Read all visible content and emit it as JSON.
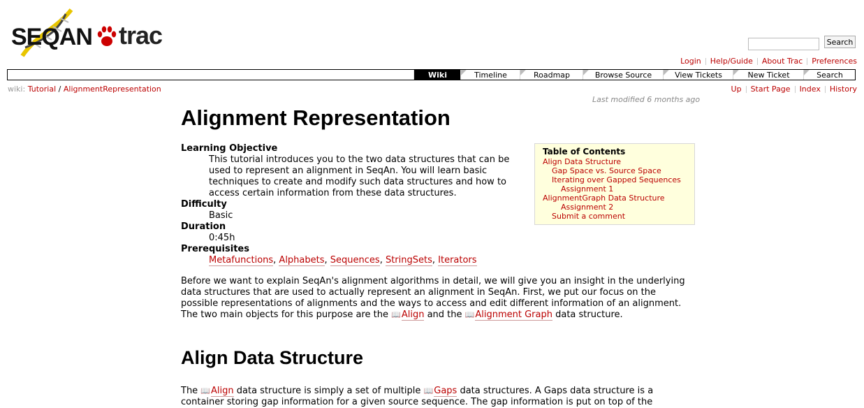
{
  "logo": {
    "left": "SEQAN",
    "right": "trac"
  },
  "search": {
    "placeholder": "",
    "button": "Search"
  },
  "metanav": [
    "Login",
    "Help/Guide",
    "About Trac",
    "Preferences"
  ],
  "mainnav": [
    "Wiki",
    "Timeline",
    "Roadmap",
    "Browse Source",
    "View Tickets",
    "New Ticket",
    "Search"
  ],
  "breadcrumb": {
    "prefix": "wiki:",
    "parent": "Tutorial",
    "sep": "/",
    "current": "AlignmentRepresentation"
  },
  "ctxtnav": [
    "Up",
    "Start Page",
    "Index",
    "History"
  ],
  "last_modified": "Last modified 6 months ago",
  "page": {
    "title": "Alignment Representation",
    "def": {
      "objective_label": "Learning Objective",
      "objective_text": "This tutorial introduces you to the two data structures that can be used to represent an alignment in SeqAn. You will learn basic techniques to create and modify such data structures and how to access certain information from these data structures.",
      "difficulty_label": "Difficulty",
      "difficulty_value": "Basic",
      "duration_label": "Duration",
      "duration_value": "0:45h",
      "prereq_label": "Prerequisites",
      "prereqs": [
        "Metafunctions",
        "Alphabets",
        "Sequences",
        "StringSets",
        "Iterators"
      ]
    },
    "intro": {
      "text1": "Before we want to explain SeqAn's alignment algorithms in detail, we will give you an insight in the underlying data structures that are used to actually represent an alignment in SeqAn. First, we put our focus on the possible representations of alignments and the ways to access and edit different information of an alignment. The two main objects for this purpose are the ",
      "link1": "Align",
      "text2": " and the ",
      "link2": "Alignment Graph",
      "text3": " data structure."
    },
    "section1_title": "Align Data Structure",
    "section1": {
      "text1": "The ",
      "link1": "Align",
      "text2": " data structure is simply a set of multiple ",
      "link2": "Gaps",
      "text3": " data structures. A Gaps data structure is a container storing gap information for a given source sequence. The gap information is put on top of the"
    }
  },
  "toc": {
    "heading": "Table of Contents",
    "items": [
      {
        "label": "Align Data Structure",
        "level": 1
      },
      {
        "label": "Gap Space vs. Source Space",
        "level": 2
      },
      {
        "label": "Iterating over Gapped Sequences",
        "level": 2
      },
      {
        "label": "Assignment 1",
        "level": 3
      },
      {
        "label": "AlignmentGraph Data Structure",
        "level": 1
      },
      {
        "label": "Assignment 2",
        "level": 3
      },
      {
        "label": "Submit a comment",
        "level": 2
      }
    ]
  },
  "colors": {
    "link": "#bb0000",
    "toc_bg": "#ffffdd",
    "active_tab": "#000000"
  }
}
